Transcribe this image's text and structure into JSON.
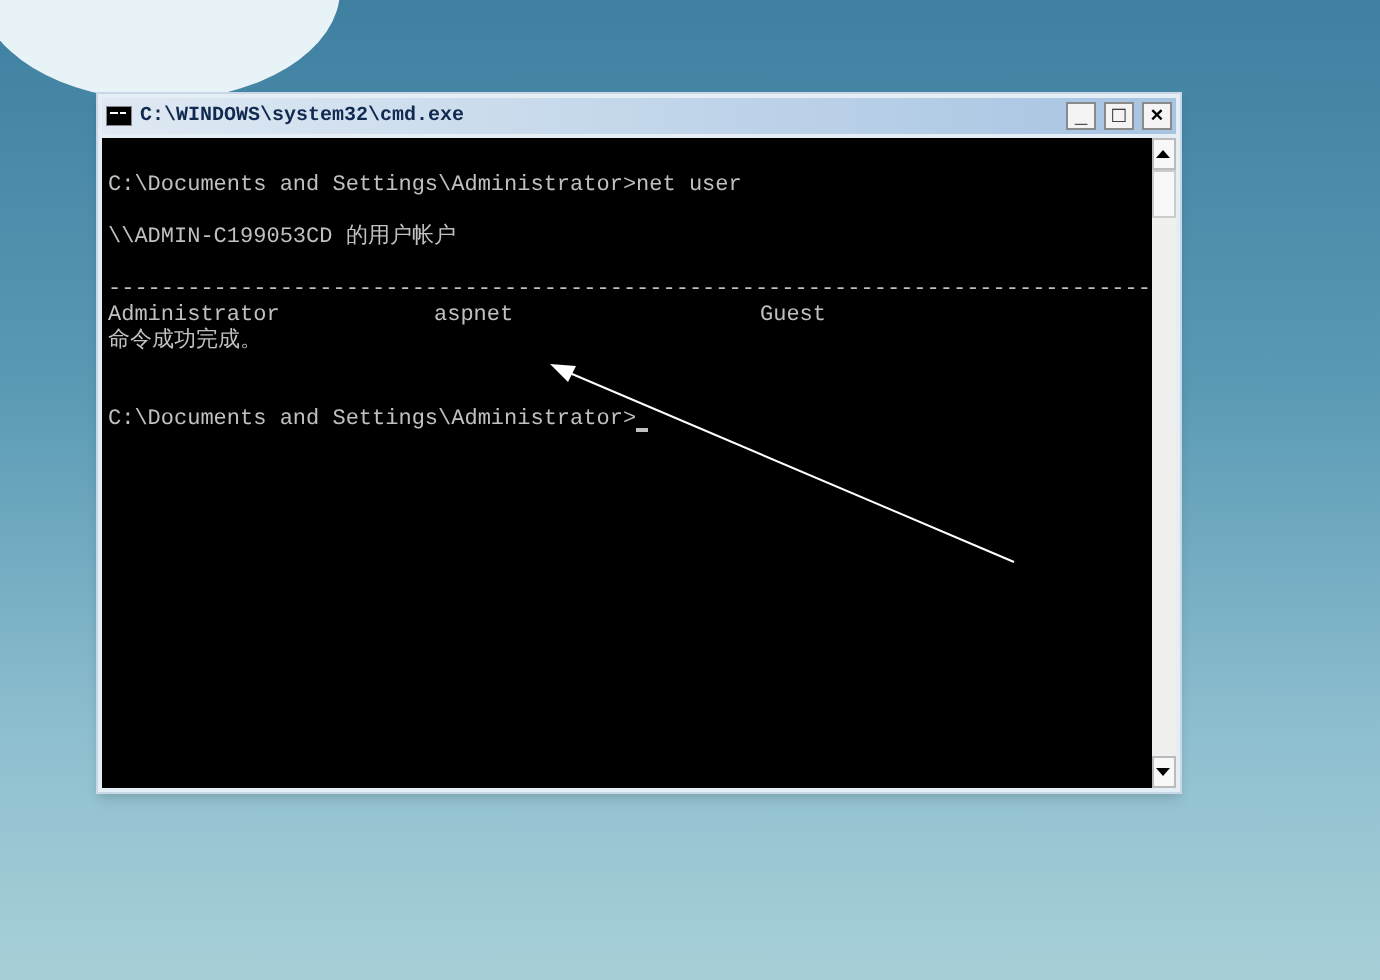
{
  "window": {
    "title": "C:\\WINDOWS\\system32\\cmd.exe",
    "buttons": [
      "_",
      "□",
      "×"
    ]
  },
  "console": {
    "lines": [
      {
        "kind": "blank"
      },
      {
        "kind": "text",
        "text": "C:\\Documents and Settings\\Administrator>net user"
      },
      {
        "kind": "blank"
      },
      {
        "kind": "text",
        "text": "\\\\ADMIN-C199053CD 的用户帐户"
      },
      {
        "kind": "blank"
      },
      {
        "kind": "rule",
        "text": "-------------------------------------------------------------------------------"
      },
      {
        "kind": "columns",
        "cells": [
          "Administrator",
          "aspnet",
          "Guest"
        ]
      },
      {
        "kind": "text",
        "text": "命令成功完成。"
      },
      {
        "kind": "blank"
      },
      {
        "kind": "blank"
      },
      {
        "kind": "prompt",
        "text": "C:\\Documents and Settings\\Administrator>",
        "cursor": true
      }
    ]
  }
}
